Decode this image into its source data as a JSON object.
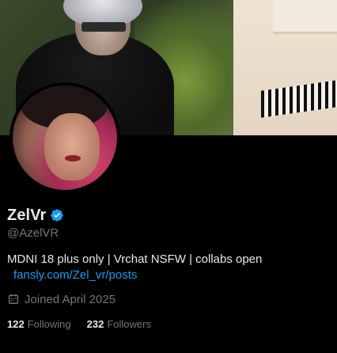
{
  "profile": {
    "display_name": "ZelVr",
    "handle": "@AzelVR",
    "bio": "MDNI 18 plus only | Vrchat NSFW | collabs open",
    "link": "fansly.com/Zel_vr/posts",
    "joined": "Joined April 2025",
    "verified": true
  },
  "stats": {
    "following_count": "122",
    "following_label": "Following",
    "followers_count": "232",
    "followers_label": "Followers"
  },
  "icons": {
    "verified": "verified-badge-icon",
    "joined": "calendar-icon"
  },
  "colors": {
    "background": "#000000",
    "primary_text": "#e7e9ea",
    "secondary_text": "#71767b",
    "link": "#1d9bf0",
    "verified": "#1d9bf0"
  }
}
